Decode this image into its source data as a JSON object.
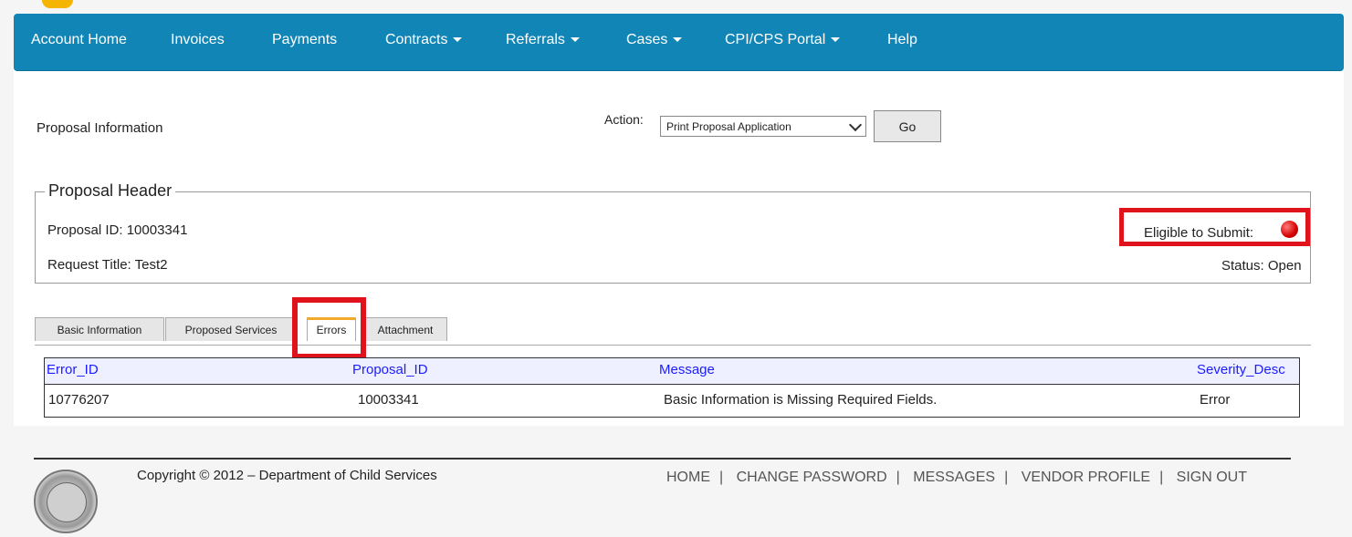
{
  "nav": {
    "items": [
      {
        "label": "Account Home",
        "dropdown": false
      },
      {
        "label": "Invoices",
        "dropdown": false
      },
      {
        "label": "Payments",
        "dropdown": false
      },
      {
        "label": "Contracts",
        "dropdown": true
      },
      {
        "label": "Referrals",
        "dropdown": true
      },
      {
        "label": "Cases",
        "dropdown": true
      },
      {
        "label": "CPI/CPS Portal",
        "dropdown": true
      },
      {
        "label": "Help",
        "dropdown": false
      }
    ]
  },
  "page": {
    "title": "Proposal Information",
    "action_label": "Action:",
    "action_value": "Print Proposal Application",
    "go_label": "Go"
  },
  "header": {
    "legend": "Proposal Header",
    "proposal_id": "Proposal ID: 10003341",
    "request_title": "Request Title: Test2",
    "eligible": "Eligible to Submit:",
    "eligible_status_color": "#d40000",
    "status": "Status: Open"
  },
  "tabs": [
    {
      "label": "Basic Information",
      "active": false
    },
    {
      "label": "Proposed Services",
      "active": false
    },
    {
      "label": "Errors",
      "active": true
    },
    {
      "label": "Attachment",
      "active": false
    }
  ],
  "grid": {
    "columns": [
      "Error_ID",
      "Proposal_ID",
      "Message",
      "Severity_Desc"
    ],
    "rows": [
      [
        "10776207",
        "10003341",
        "Basic Information is Missing Required Fields.",
        "Error"
      ]
    ]
  },
  "footer": {
    "copyright": "Copyright © 2012 – Department of Child Services",
    "links": [
      "HOME",
      "CHANGE PASSWORD",
      "MESSAGES",
      "VENDOR PROFILE",
      "SIGN OUT"
    ],
    "separator": "|"
  },
  "colors": {
    "navbar": "#1185b6",
    "highlight": "#e0121b",
    "tab_accent": "#f2a92d",
    "grid_header_text": "#1c1cff"
  }
}
